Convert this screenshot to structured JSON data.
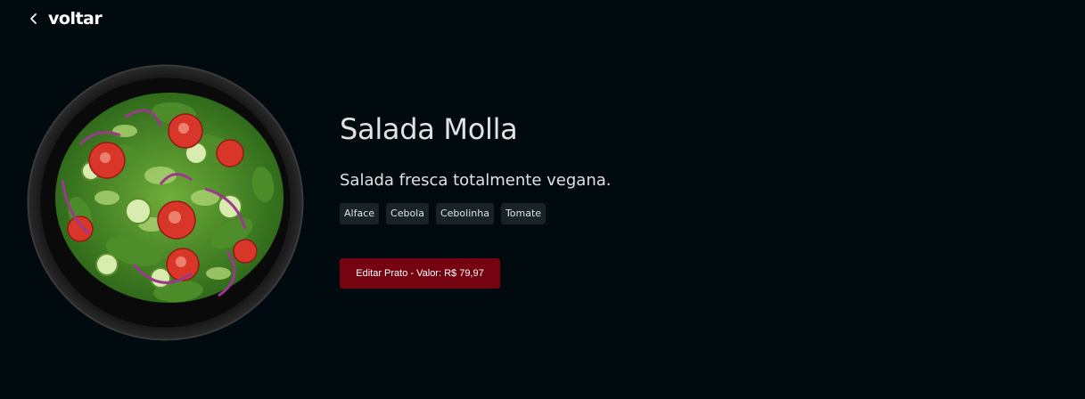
{
  "nav": {
    "back_label": "voltar",
    "back_icon": "chevron-left-icon"
  },
  "dish": {
    "image_alt": "salad-bowl",
    "title": "Salada Molla",
    "description": "Salada fresca totalmente vegana.",
    "ingredients": [
      "Alface",
      "Cebola",
      "Cebolinha",
      "Tomate"
    ],
    "edit_button_label": "Editar Prato - Valor: R$ 79,97"
  },
  "colors": {
    "background": "#000A0F",
    "text": "#E1E1E6",
    "tag_background": "#192227",
    "button": "#750310"
  }
}
